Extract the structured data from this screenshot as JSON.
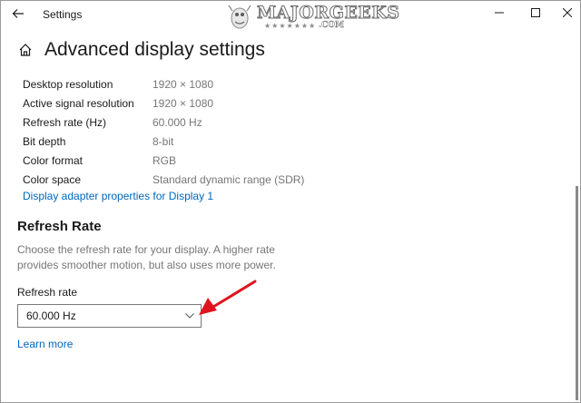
{
  "window": {
    "title": "Settings",
    "back_icon": "arrow-left-icon",
    "minimize_icon": "minimize-icon",
    "maximize_icon": "maximize-icon",
    "close_icon": "close-icon"
  },
  "watermark": {
    "text": "MAJORGEEKS",
    "stars": "★★★★★★★",
    "suffix": ".COM"
  },
  "header": {
    "home_icon": "home-icon",
    "title": "Advanced display settings"
  },
  "display_info": [
    {
      "label": "Desktop resolution",
      "value": "1920 × 1080"
    },
    {
      "label": "Active signal resolution",
      "value": "1920 × 1080"
    },
    {
      "label": "Refresh rate (Hz)",
      "value": "60.000 Hz"
    },
    {
      "label": "Bit depth",
      "value": "8-bit"
    },
    {
      "label": "Color format",
      "value": "RGB"
    },
    {
      "label": "Color space",
      "value": "Standard dynamic range (SDR)"
    }
  ],
  "adapter_link": "Display adapter properties for Display 1",
  "refresh_section": {
    "title": "Refresh Rate",
    "description": "Choose the refresh rate for your display. A higher rate provides smoother motion, but also uses more power.",
    "field_label": "Refresh rate",
    "selected_value": "60.000 Hz",
    "learn_more": "Learn more"
  },
  "colors": {
    "accent_link": "#0067c0",
    "annotation_arrow": "#e0141e",
    "secondary_text": "#767676"
  }
}
